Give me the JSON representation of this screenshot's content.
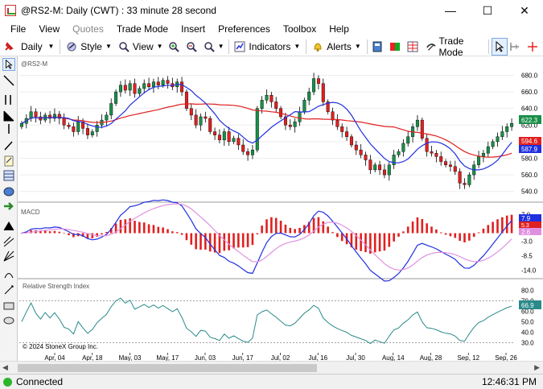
{
  "window": {
    "title": "@RS2-M: Daily (CWT) : 33 minute 28 second",
    "minimize_glyph": "—",
    "maximize_glyph": "☐",
    "close_glyph": "✕"
  },
  "menu": [
    "File",
    "View",
    "Quotes",
    "Trade Mode",
    "Insert",
    "Preferences",
    "Toolbox",
    "Help"
  ],
  "toolbar": {
    "interval": "Daily",
    "style_label": "Style",
    "view_label": "View",
    "indicators_label": "Indicators",
    "alerts_label": "Alerts",
    "trade_mode_label": "Trade Mode"
  },
  "sidebar_icons": [
    "pointer-icon",
    "line-tool-icon",
    "bar-tool-icon",
    "ray-tool-icon",
    "horizontal-line-icon",
    "pencil-icon",
    "note-icon",
    "fibonacci-icon",
    "ellipse-icon",
    "arrow-icon",
    "pitchfork-icon",
    "channel-icon",
    "fan-icon",
    "arc-icon",
    "text-tool-icon",
    "rectangle-icon",
    "oval-icon"
  ],
  "chart": {
    "symbol_label": "@RS2-M",
    "macd_label": "MACD",
    "rsi_label": "Relative Strength Index",
    "copyright": "© 2024 StoneX Group Inc.",
    "colors": {
      "up": "#1a8f4a",
      "down": "#e02020",
      "sma_fast": "#2030e0",
      "sma_slow": "#e02020",
      "rsi": "#2a8a8a",
      "macd_line": "#2030e0",
      "signal_line": "#e090e0",
      "hist_pos": "#e02020"
    }
  },
  "chart_data": [
    {
      "type": "candlestick",
      "title": "@RS2-M",
      "ylim": [
        530,
        695
      ],
      "y_ticks": [
        540.0,
        560.0,
        580.0,
        600.0,
        620.0,
        640.0,
        660.0,
        680.0
      ],
      "x_ticks": [
        "Apr, 04",
        "Apr, 18",
        "May, 03",
        "May, 17",
        "Jun, 03",
        "Jun, 17",
        "Jul, 02",
        "Jul, 16",
        "Jul, 30",
        "Aug, 14",
        "Aug, 28",
        "Sep, 12",
        "Sep, 26"
      ],
      "closes": [
        622,
        628,
        636,
        630,
        626,
        632,
        628,
        633,
        628,
        620,
        618,
        612,
        624,
        616,
        608,
        612,
        620,
        626,
        632,
        646,
        660,
        668,
        662,
        670,
        658,
        664,
        670,
        666,
        672,
        668,
        674,
        670,
        666,
        672,
        660,
        640,
        632,
        620,
        630,
        628,
        612,
        608,
        602,
        612,
        600,
        604,
        596,
        588,
        584,
        590,
        640,
        650,
        656,
        648,
        640,
        630,
        620,
        618,
        624,
        636,
        650,
        660,
        676,
        670,
        648,
        636,
        626,
        618,
        612,
        606,
        596,
        590,
        584,
        578,
        566,
        572,
        566,
        560,
        572,
        584,
        588,
        598,
        606,
        618,
        626,
        604,
        588,
        586,
        582,
        576,
        572,
        570,
        564,
        550,
        548,
        560,
        572,
        582,
        586,
        594,
        600,
        606,
        612,
        618,
        622
      ],
      "last_value": 622.3,
      "sma_fast_last": 587.9,
      "sma_slow_last": 594.6
    },
    {
      "type": "macd",
      "title": "MACD",
      "y_ticks": [
        7.0,
        2.0,
        -3.0,
        -8.5,
        -14.0
      ],
      "last_macd": 7.9,
      "last_signal": 2.6,
      "last_hist": 5.3
    },
    {
      "type": "line",
      "title": "Relative Strength Index",
      "ylim": [
        25,
        85
      ],
      "y_ticks": [
        80.0,
        70.0,
        60.0,
        50.0,
        40.0,
        30.0
      ],
      "last_value": 66.9
    }
  ],
  "status": {
    "connection": "Connected",
    "time": "12:46:31 PM"
  }
}
